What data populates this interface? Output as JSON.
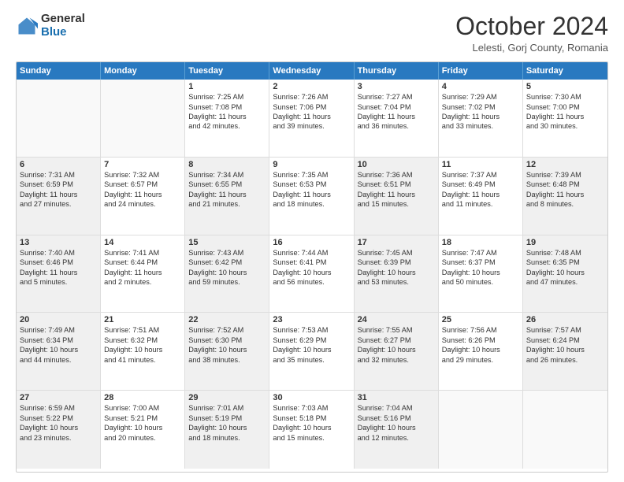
{
  "logo": {
    "general": "General",
    "blue": "Blue"
  },
  "title": "October 2024",
  "subtitle": "Lelesti, Gorj County, Romania",
  "header_days": [
    "Sunday",
    "Monday",
    "Tuesday",
    "Wednesday",
    "Thursday",
    "Friday",
    "Saturday"
  ],
  "weeks": [
    [
      {
        "day": "",
        "lines": [],
        "empty": true
      },
      {
        "day": "",
        "lines": [],
        "empty": true
      },
      {
        "day": "1",
        "lines": [
          "Sunrise: 7:25 AM",
          "Sunset: 7:08 PM",
          "Daylight: 11 hours",
          "and 42 minutes."
        ]
      },
      {
        "day": "2",
        "lines": [
          "Sunrise: 7:26 AM",
          "Sunset: 7:06 PM",
          "Daylight: 11 hours",
          "and 39 minutes."
        ]
      },
      {
        "day": "3",
        "lines": [
          "Sunrise: 7:27 AM",
          "Sunset: 7:04 PM",
          "Daylight: 11 hours",
          "and 36 minutes."
        ]
      },
      {
        "day": "4",
        "lines": [
          "Sunrise: 7:29 AM",
          "Sunset: 7:02 PM",
          "Daylight: 11 hours",
          "and 33 minutes."
        ]
      },
      {
        "day": "5",
        "lines": [
          "Sunrise: 7:30 AM",
          "Sunset: 7:00 PM",
          "Daylight: 11 hours",
          "and 30 minutes."
        ]
      }
    ],
    [
      {
        "day": "6",
        "lines": [
          "Sunrise: 7:31 AM",
          "Sunset: 6:59 PM",
          "Daylight: 11 hours",
          "and 27 minutes."
        ],
        "shaded": true
      },
      {
        "day": "7",
        "lines": [
          "Sunrise: 7:32 AM",
          "Sunset: 6:57 PM",
          "Daylight: 11 hours",
          "and 24 minutes."
        ]
      },
      {
        "day": "8",
        "lines": [
          "Sunrise: 7:34 AM",
          "Sunset: 6:55 PM",
          "Daylight: 11 hours",
          "and 21 minutes."
        ],
        "shaded": true
      },
      {
        "day": "9",
        "lines": [
          "Sunrise: 7:35 AM",
          "Sunset: 6:53 PM",
          "Daylight: 11 hours",
          "and 18 minutes."
        ]
      },
      {
        "day": "10",
        "lines": [
          "Sunrise: 7:36 AM",
          "Sunset: 6:51 PM",
          "Daylight: 11 hours",
          "and 15 minutes."
        ],
        "shaded": true
      },
      {
        "day": "11",
        "lines": [
          "Sunrise: 7:37 AM",
          "Sunset: 6:49 PM",
          "Daylight: 11 hours",
          "and 11 minutes."
        ]
      },
      {
        "day": "12",
        "lines": [
          "Sunrise: 7:39 AM",
          "Sunset: 6:48 PM",
          "Daylight: 11 hours",
          "and 8 minutes."
        ],
        "shaded": true
      }
    ],
    [
      {
        "day": "13",
        "lines": [
          "Sunrise: 7:40 AM",
          "Sunset: 6:46 PM",
          "Daylight: 11 hours",
          "and 5 minutes."
        ],
        "shaded": true
      },
      {
        "day": "14",
        "lines": [
          "Sunrise: 7:41 AM",
          "Sunset: 6:44 PM",
          "Daylight: 11 hours",
          "and 2 minutes."
        ]
      },
      {
        "day": "15",
        "lines": [
          "Sunrise: 7:43 AM",
          "Sunset: 6:42 PM",
          "Daylight: 10 hours",
          "and 59 minutes."
        ],
        "shaded": true
      },
      {
        "day": "16",
        "lines": [
          "Sunrise: 7:44 AM",
          "Sunset: 6:41 PM",
          "Daylight: 10 hours",
          "and 56 minutes."
        ]
      },
      {
        "day": "17",
        "lines": [
          "Sunrise: 7:45 AM",
          "Sunset: 6:39 PM",
          "Daylight: 10 hours",
          "and 53 minutes."
        ],
        "shaded": true
      },
      {
        "day": "18",
        "lines": [
          "Sunrise: 7:47 AM",
          "Sunset: 6:37 PM",
          "Daylight: 10 hours",
          "and 50 minutes."
        ]
      },
      {
        "day": "19",
        "lines": [
          "Sunrise: 7:48 AM",
          "Sunset: 6:35 PM",
          "Daylight: 10 hours",
          "and 47 minutes."
        ],
        "shaded": true
      }
    ],
    [
      {
        "day": "20",
        "lines": [
          "Sunrise: 7:49 AM",
          "Sunset: 6:34 PM",
          "Daylight: 10 hours",
          "and 44 minutes."
        ],
        "shaded": true
      },
      {
        "day": "21",
        "lines": [
          "Sunrise: 7:51 AM",
          "Sunset: 6:32 PM",
          "Daylight: 10 hours",
          "and 41 minutes."
        ]
      },
      {
        "day": "22",
        "lines": [
          "Sunrise: 7:52 AM",
          "Sunset: 6:30 PM",
          "Daylight: 10 hours",
          "and 38 minutes."
        ],
        "shaded": true
      },
      {
        "day": "23",
        "lines": [
          "Sunrise: 7:53 AM",
          "Sunset: 6:29 PM",
          "Daylight: 10 hours",
          "and 35 minutes."
        ]
      },
      {
        "day": "24",
        "lines": [
          "Sunrise: 7:55 AM",
          "Sunset: 6:27 PM",
          "Daylight: 10 hours",
          "and 32 minutes."
        ],
        "shaded": true
      },
      {
        "day": "25",
        "lines": [
          "Sunrise: 7:56 AM",
          "Sunset: 6:26 PM",
          "Daylight: 10 hours",
          "and 29 minutes."
        ]
      },
      {
        "day": "26",
        "lines": [
          "Sunrise: 7:57 AM",
          "Sunset: 6:24 PM",
          "Daylight: 10 hours",
          "and 26 minutes."
        ],
        "shaded": true
      }
    ],
    [
      {
        "day": "27",
        "lines": [
          "Sunrise: 6:59 AM",
          "Sunset: 5:22 PM",
          "Daylight: 10 hours",
          "and 23 minutes."
        ],
        "shaded": true
      },
      {
        "day": "28",
        "lines": [
          "Sunrise: 7:00 AM",
          "Sunset: 5:21 PM",
          "Daylight: 10 hours",
          "and 20 minutes."
        ]
      },
      {
        "day": "29",
        "lines": [
          "Sunrise: 7:01 AM",
          "Sunset: 5:19 PM",
          "Daylight: 10 hours",
          "and 18 minutes."
        ],
        "shaded": true
      },
      {
        "day": "30",
        "lines": [
          "Sunrise: 7:03 AM",
          "Sunset: 5:18 PM",
          "Daylight: 10 hours",
          "and 15 minutes."
        ]
      },
      {
        "day": "31",
        "lines": [
          "Sunrise: 7:04 AM",
          "Sunset: 5:16 PM",
          "Daylight: 10 hours",
          "and 12 minutes."
        ],
        "shaded": true
      },
      {
        "day": "",
        "lines": [],
        "empty": true
      },
      {
        "day": "",
        "lines": [],
        "empty": true
      }
    ]
  ]
}
